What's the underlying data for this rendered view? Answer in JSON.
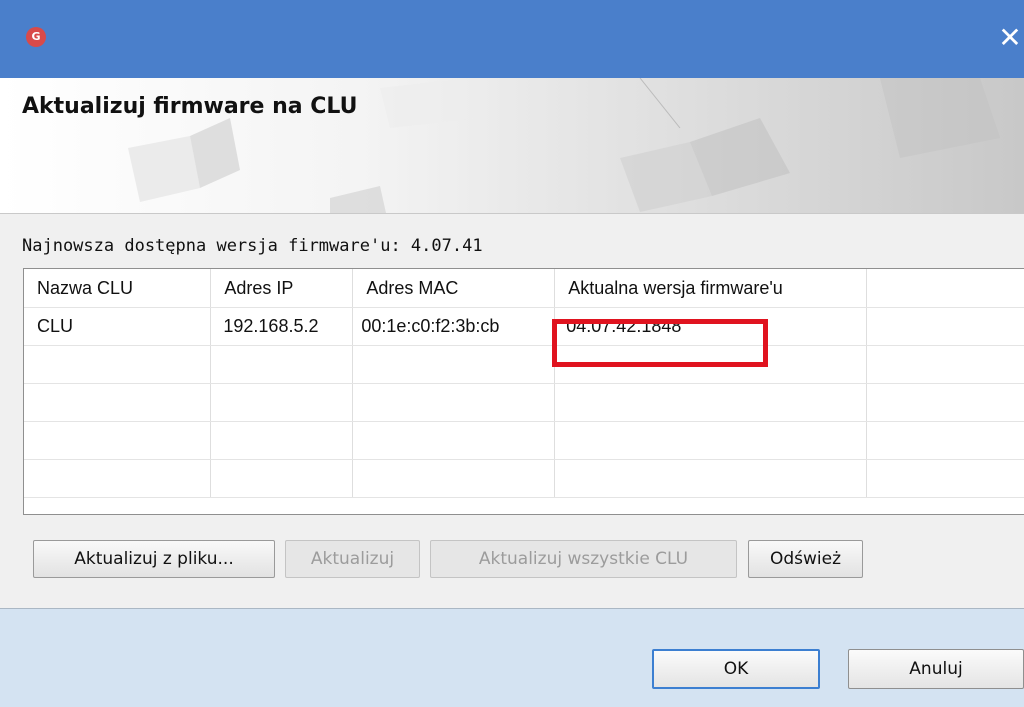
{
  "window": {
    "title": "",
    "app_icon": "grenton-gear-icon",
    "close_glyph": "✕"
  },
  "header": {
    "title": "Aktualizuj firmware na CLU"
  },
  "info": {
    "latest_version": "Najnowsza dostępna wersja firmware'u: 4.07.41"
  },
  "table": {
    "columns": [
      "Nazwa CLU",
      "Adres IP",
      "Adres MAC",
      "Aktualna wersja firmware'u"
    ],
    "rows": [
      {
        "name": "CLU",
        "ip": "192.168.5.2",
        "mac": "00:1e:c0:f2:3b:cb",
        "firmware": "04.07.42.1848"
      }
    ],
    "empty_rows": 4,
    "highlight_color": "#e0131f"
  },
  "buttons": {
    "update_from_file": "Aktualizuj z pliku...",
    "update": "Aktualizuj",
    "update_all": "Aktualizuj wszystkie CLU",
    "refresh": "Odśwież"
  },
  "footer": {
    "ok": "OK",
    "cancel": "Anuluj"
  }
}
